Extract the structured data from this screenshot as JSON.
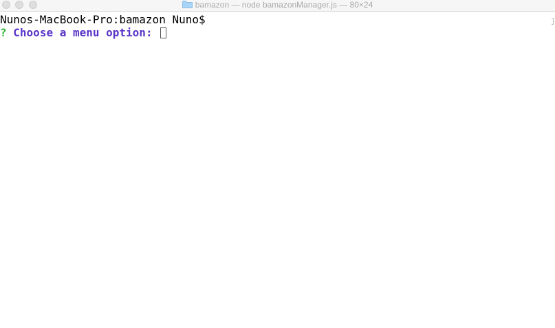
{
  "window": {
    "title": "bamazon — node bamazonManager.js — 80×24"
  },
  "terminal": {
    "shell_prompt": "Nunos-MacBook-Pro:bamazon Nuno$",
    "question_mark": "?",
    "menu_prompt": "Choose a menu option:"
  },
  "colors": {
    "question_mark": "#2fb82f",
    "menu_prompt": "#5a35c8",
    "title_text": "#a9a9a9"
  },
  "icons": {
    "title_folder": "folder-icon"
  }
}
